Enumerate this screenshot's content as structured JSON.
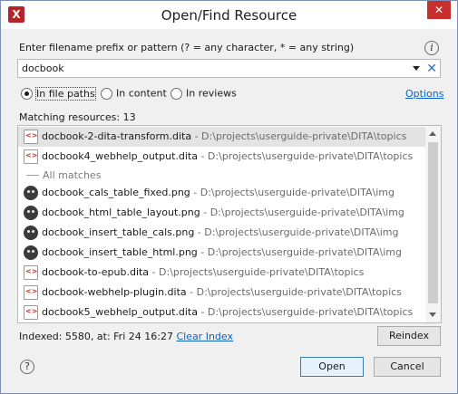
{
  "window": {
    "title": "Open/Find Resource",
    "app_icon": "oxygen-x-icon",
    "close_glyph": "✕"
  },
  "search": {
    "label": "Enter filename prefix or pattern (? = any character, * = any string)",
    "value": "docbook",
    "info_glyph": "i",
    "clear_glyph": "✕"
  },
  "scope": {
    "options": [
      {
        "label": "In file paths",
        "selected": true
      },
      {
        "label": "In content",
        "selected": false
      },
      {
        "label": "In reviews",
        "selected": false
      }
    ],
    "options_link": "Options"
  },
  "results": {
    "count_label": "Matching resources: 13",
    "separator_label": "All matches",
    "items": [
      {
        "name": "docbook-2-dita-transform.dita",
        "path": " - D:\\projects\\userguide-private\\DITA\\topics",
        "icon": "dita-file-icon",
        "selected": true
      },
      {
        "name": "docbook4_webhelp_output.dita",
        "path": " - D:\\projects\\userguide-private\\DITA\\topics",
        "icon": "dita-file-icon",
        "selected": false
      },
      {
        "name": "docbook_cals_table_fixed.png",
        "path": " - D:\\projects\\userguide-private\\DITA\\img",
        "icon": "png-image-icon",
        "selected": false
      },
      {
        "name": "docbook_html_table_layout.png",
        "path": " - D:\\projects\\userguide-private\\DITA\\img",
        "icon": "png-image-icon",
        "selected": false
      },
      {
        "name": "docbook_insert_table_cals.png",
        "path": " - D:\\projects\\userguide-private\\DITA\\img",
        "icon": "png-image-icon",
        "selected": false
      },
      {
        "name": "docbook_insert_table_html.png",
        "path": " - D:\\projects\\userguide-private\\DITA\\img",
        "icon": "png-image-icon",
        "selected": false
      },
      {
        "name": "docbook-to-epub.dita",
        "path": " - D:\\projects\\userguide-private\\DITA\\topics",
        "icon": "dita-file-icon",
        "selected": false
      },
      {
        "name": "docbook-webhelp-plugin.dita",
        "path": " - D:\\projects\\userguide-private\\DITA\\topics",
        "icon": "dita-file-icon",
        "selected": false
      },
      {
        "name": "docbook5_webhelp_output.dita",
        "path": " - D:\\projects\\userguide-private\\DITA\\topics",
        "icon": "dita-file-icon",
        "selected": false
      }
    ]
  },
  "footer": {
    "indexed_text": "Indexed: 5580, at: Fri 24 16:27",
    "clear_index": "Clear Index",
    "reindex": "Reindex",
    "open": "Open",
    "cancel": "Cancel",
    "help_glyph": "?"
  },
  "colors": {
    "close_button": "#c7302c",
    "link": "#0b62c4",
    "selection": "#e3e3e3",
    "primary_button_border": "#3c7fb1"
  }
}
